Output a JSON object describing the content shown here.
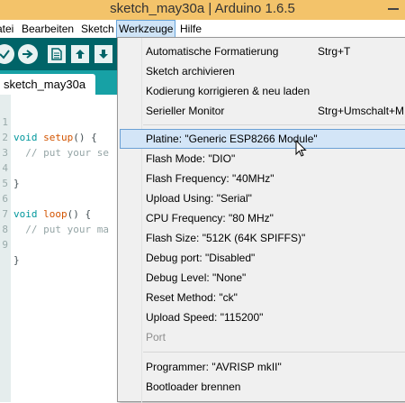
{
  "window": {
    "title": "sketch_may30a | Arduino 1.6.5"
  },
  "menubar": {
    "items": [
      "atei",
      "Bearbeiten",
      "Sketch",
      "Werkzeuge",
      "Hilfe"
    ],
    "active": "Werkzeuge"
  },
  "toolbar": {
    "buttons": [
      "verify-icon",
      "upload-icon",
      "new-icon",
      "open-icon",
      "save-icon"
    ]
  },
  "tabs": [
    {
      "label": "sketch_may30a"
    }
  ],
  "editor": {
    "lines": [
      {
        "n": "1",
        "text": "void setup() {"
      },
      {
        "n": "2",
        "text": "  // put your se"
      },
      {
        "n": "3",
        "text": ""
      },
      {
        "n": "4",
        "text": "}"
      },
      {
        "n": "5",
        "text": ""
      },
      {
        "n": "6",
        "text": "void loop() {"
      },
      {
        "n": "7",
        "text": "  // put your ma"
      },
      {
        "n": "8",
        "text": ""
      },
      {
        "n": "9",
        "text": "}"
      }
    ]
  },
  "menu": {
    "items": [
      {
        "label": "Automatische Formatierung",
        "shortcut": "Strg+T"
      },
      {
        "label": "Sketch archivieren",
        "shortcut": ""
      },
      {
        "label": "Kodierung korrigieren & neu laden",
        "shortcut": ""
      },
      {
        "label": "Serieller Monitor",
        "shortcut": "Strg+Umschalt+M"
      },
      {
        "label": "Platine: \"Generic ESP8266 Module\"",
        "shortcut": "",
        "state": "selected"
      },
      {
        "label": "Flash Mode: \"DIO\"",
        "shortcut": ""
      },
      {
        "label": "Flash Frequency: \"40MHz\"",
        "shortcut": ""
      },
      {
        "label": "Upload Using: \"Serial\"",
        "shortcut": ""
      },
      {
        "label": "CPU Frequency: \"80 MHz\"",
        "shortcut": ""
      },
      {
        "label": "Flash Size: \"512K (64K SPIFFS)\"",
        "shortcut": ""
      },
      {
        "label": "Debug port: \"Disabled\"",
        "shortcut": ""
      },
      {
        "label": "Debug Level: \"None\"",
        "shortcut": ""
      },
      {
        "label": "Reset Method: \"ck\"",
        "shortcut": ""
      },
      {
        "label": "Upload Speed: \"115200\"",
        "shortcut": ""
      },
      {
        "label": "Port",
        "shortcut": "",
        "state": "disabled"
      },
      {
        "label": "Programmer: \"AVRISP mkII\"",
        "shortcut": ""
      },
      {
        "label": "Bootloader brennen",
        "shortcut": ""
      }
    ]
  },
  "colors": {
    "titlebar": "#f3c36a",
    "toolbar": "#006468",
    "tabbar": "#17a1a5",
    "menu_highlight": "#d3e5f7"
  }
}
